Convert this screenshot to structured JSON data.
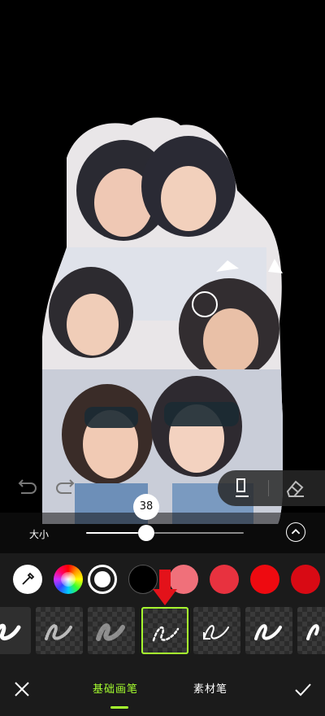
{
  "size_control": {
    "label": "大小",
    "value": "38",
    "fraction": 0.38
  },
  "colors": {
    "swatches": [
      "#000000",
      "#f0707a",
      "#e8323f",
      "#ee0a10",
      "#d80a14"
    ],
    "accent": "#a6ff2f"
  },
  "tabs": {
    "basic": "基础画笔",
    "material": "素材笔"
  },
  "icons": [
    "undo-icon",
    "redo-icon",
    "brush-icon",
    "eraser-icon",
    "chevron-up-icon",
    "eyedropper-icon",
    "color-wheel-icon",
    "close-icon",
    "check-icon",
    "down-arrow-icon"
  ]
}
